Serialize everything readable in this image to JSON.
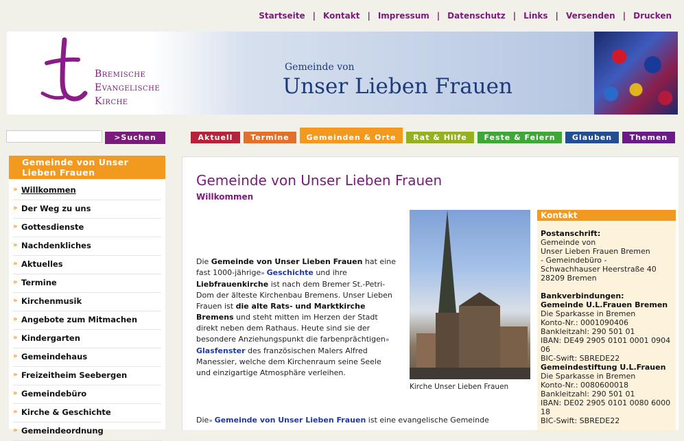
{
  "toplinks": [
    "Startseite",
    "Kontakt",
    "Impressum",
    "Datenschutz",
    "Links",
    "Versenden",
    "Drucken"
  ],
  "header": {
    "logo_lines": [
      "Bremische",
      "Evangelische",
      "Kirche"
    ],
    "parish_small": "Gemeinde von",
    "parish_big": "Unser Lieben Frauen"
  },
  "search": {
    "value": "",
    "button": ">Suchen"
  },
  "tabs": [
    {
      "label": "Aktuell",
      "color": "#b5233a"
    },
    {
      "label": "Termine",
      "color": "#e2702a"
    },
    {
      "label": "Gemeinden & Orte",
      "color": "#f2991f"
    },
    {
      "label": "Rat & Hilfe",
      "color": "#95b121"
    },
    {
      "label": "Feste & Feiern",
      "color": "#3fa63a"
    },
    {
      "label": "Glauben",
      "color": "#234e8f"
    },
    {
      "label": "Themen",
      "color": "#6b1b87"
    }
  ],
  "sidebar": {
    "title": "Gemeinde von Unser Lieben Frauen",
    "items": [
      "Willkommen",
      "Der Weg zu uns",
      "Gottesdienste",
      "Nachdenkliches",
      "Aktuelles",
      "Termine",
      "Kirchenmusik",
      "Angebote zum Mitmachen",
      "Kindergarten",
      "Gemeindehaus",
      "Freizeitheim Seebergen",
      "Gemeindebüro",
      "Kirche & Geschichte",
      "Gemeindeordnung"
    ]
  },
  "main": {
    "title": "Gemeinde von Unser Lieben Frauen",
    "subtitle": "Willkommen",
    "p1": {
      "t1": "Die ",
      "b1": "Gemeinde von Unser Lieben Frauen",
      "t2": " hat eine fast 1000-jährige",
      "l1": "Geschichte",
      "t3": " und ihre ",
      "b2": "Liebfrauenkirche",
      "t4": " ist nach dem Bremer St.-Petri-Dom der älteste Kirchenbau Bremens. Unser Lieben Frauen ist ",
      "b3": "die alte Rats- und Marktkirche Bremens",
      "t5": " und steht mitten im Herzen der Stadt direkt neben dem Rathaus. Heute sind sie der besondere Anziehungspunkt die farbenprächtigen",
      "l2": "Glasfenster",
      "t6": " des französischen Malers Alfred Manessier, welche dem Kirchenraum seine Seele und einzigartige Atmosphäre verleihen."
    },
    "p2": {
      "t1": "Die",
      "l1": "Gemeinde von Unser Lieben Frauen",
      "t2": " ist eine evangelische Gemeinde"
    },
    "caption": "Kirche Unser Lieben Frauen"
  },
  "contact": {
    "title": "Kontakt",
    "postal_label": "Postanschrift:",
    "postal": [
      "Gemeinde von",
      "Unser Lieben Frauen Bremen",
      "- Gemeindebüro -",
      "Schwachhauser Heerstraße 40",
      "28209 Bremen"
    ],
    "bank_label": "Bankverbindungen:",
    "bank1_label": "Gemeinde U.L.Frauen Bremen",
    "bank1": [
      "Die Sparkasse in Bremen",
      "Konto-Nr.: 0001090406",
      "Bankleitzahl: 290 501 01",
      "IBAN: DE49 2905 0101 0001 0904",
      "06",
      "BIC-Swift: SBREDE22"
    ],
    "bank2_label": "Gemeindestiftung U.L.Frauen",
    "bank2": [
      "Die Sparkasse in Bremen",
      "Konto-Nr.: 0080600018",
      "Bankleitzahl: 290 501 01",
      "IBAN: DE02 2905 0101 0080 6000",
      "18",
      "BIC-Swift: SBREDE22"
    ]
  }
}
